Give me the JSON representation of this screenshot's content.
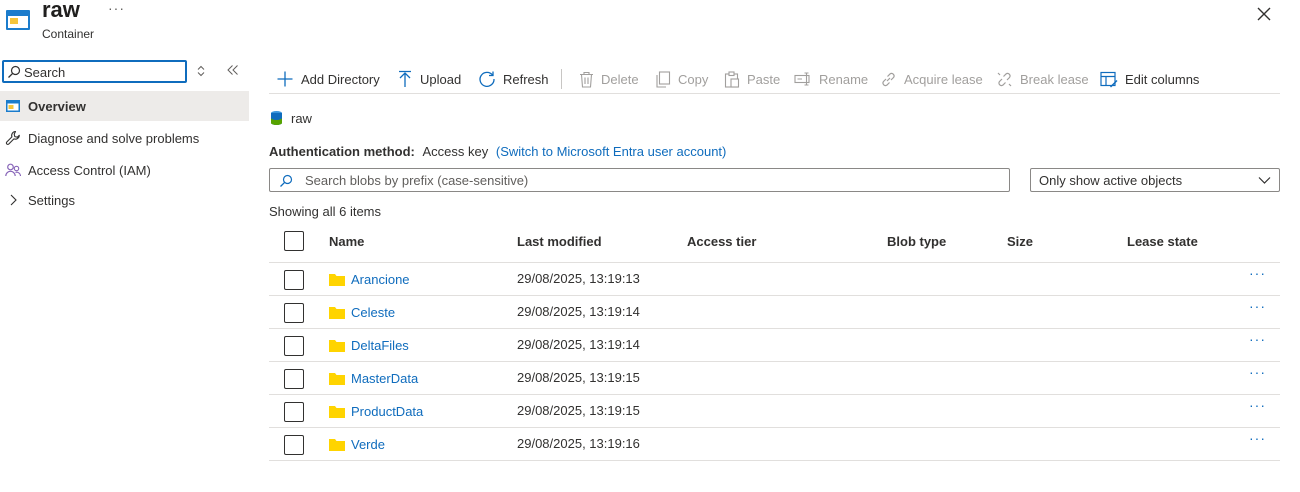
{
  "header": {
    "title": "raw",
    "subtitle": "Container",
    "more": "···"
  },
  "sidebar": {
    "search_placeholder": "Search",
    "items": [
      {
        "label": "Overview",
        "icon": "container-icon",
        "active": true
      },
      {
        "label": "Diagnose and solve problems",
        "icon": "wrench-icon"
      },
      {
        "label": "Access Control (IAM)",
        "icon": "people-icon"
      },
      {
        "label": "Settings",
        "icon": "chevron-right-icon"
      }
    ]
  },
  "toolbar": {
    "add_directory": "Add Directory",
    "upload": "Upload",
    "refresh": "Refresh",
    "delete": "Delete",
    "copy": "Copy",
    "paste": "Paste",
    "rename": "Rename",
    "acquire_lease": "Acquire lease",
    "break_lease": "Break lease",
    "edit_columns": "Edit columns"
  },
  "breadcrumb": {
    "label": "raw"
  },
  "auth": {
    "key": "Authentication method:",
    "value": "Access key",
    "switch_link": "(Switch to Microsoft Entra user account)"
  },
  "blob_search": {
    "placeholder": "Search blobs by prefix (case-sensitive)"
  },
  "filter": {
    "selected": "Only show active objects"
  },
  "list": {
    "count_text": "Showing all 6 items",
    "columns": [
      "Name",
      "Last modified",
      "Access tier",
      "Blob type",
      "Size",
      "Lease state"
    ],
    "rows": [
      {
        "name": "Arancione",
        "last_modified": "29/08/2025, 13:19:13"
      },
      {
        "name": "Celeste",
        "last_modified": "29/08/2025, 13:19:14"
      },
      {
        "name": "DeltaFiles",
        "last_modified": "29/08/2025, 13:19:14"
      },
      {
        "name": "MasterData",
        "last_modified": "29/08/2025, 13:19:15"
      },
      {
        "name": "ProductData",
        "last_modified": "29/08/2025, 13:19:15"
      },
      {
        "name": "Verde",
        "last_modified": "29/08/2025, 13:19:16"
      }
    ],
    "row_more": "···"
  },
  "colors": {
    "accent": "#0f6cbd",
    "folder": "#ffd400",
    "active_bg": "#edebe9"
  }
}
